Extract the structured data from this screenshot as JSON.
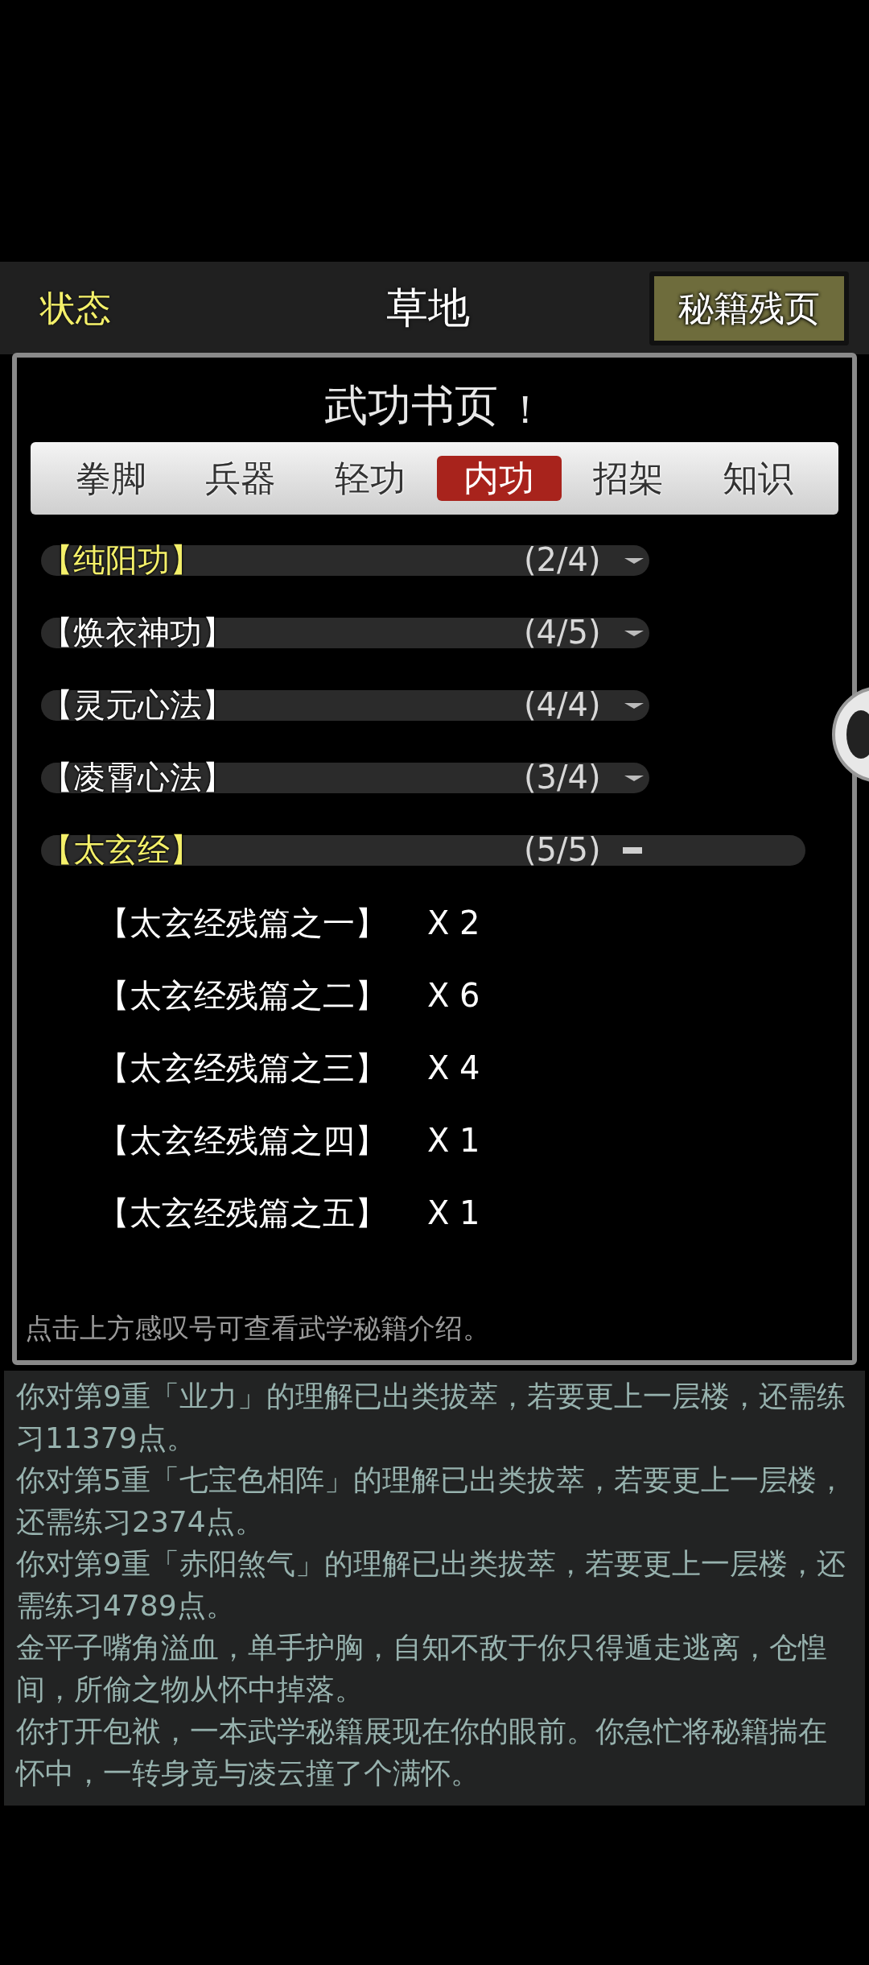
{
  "header": {
    "left": "状态",
    "title": "草地",
    "button": "秘籍残页"
  },
  "dialog": {
    "title": "武功书页",
    "title_mark": "！",
    "tabs": [
      {
        "label": "拳脚",
        "selected": false
      },
      {
        "label": "兵器",
        "selected": false
      },
      {
        "label": "轻功",
        "selected": false
      },
      {
        "label": "内功",
        "selected": true
      },
      {
        "label": "招架",
        "selected": false
      },
      {
        "label": "知识",
        "selected": false
      }
    ],
    "books": [
      {
        "name": "【纯阳功】",
        "count": "(2/4)",
        "highlighted": true,
        "expanded": false
      },
      {
        "name": "【焕衣神功】",
        "count": "(4/5)",
        "highlighted": false,
        "expanded": false
      },
      {
        "name": "【灵元心法】",
        "count": "(4/4)",
        "highlighted": false,
        "expanded": false
      },
      {
        "name": "【凌霄心法】",
        "count": "(3/4)",
        "highlighted": false,
        "expanded": false
      },
      {
        "name": "【太玄经】",
        "count": "(5/5)",
        "highlighted": true,
        "expanded": true,
        "children": [
          {
            "name": "【太玄经残篇之一】",
            "qty": "X 2"
          },
          {
            "name": "【太玄经残篇之二】",
            "qty": "X 6"
          },
          {
            "name": "【太玄经残篇之三】",
            "qty": "X 4"
          },
          {
            "name": "【太玄经残篇之四】",
            "qty": "X 1"
          },
          {
            "name": "【太玄经残篇之五】",
            "qty": "X 1"
          }
        ]
      }
    ],
    "hint": "点击上方感叹号可查看武学秘籍介绍。"
  },
  "log": [
    "你对第9重「业力」的理解已出类拔萃，若要更上一层楼，还需练习11379点。",
    "你对第5重「七宝色相阵」的理解已出类拔萃，若要更上一层楼，还需练习2374点。",
    "你对第9重「赤阳煞气」的理解已出类拔萃，若要更上一层楼，还需练习4789点。",
    "金平子嘴角溢血，单手护胸，自知不敌于你只得遁走逃离，仓惶间，所偷之物从怀中掉落。",
    "你打开包袱，一本武学秘籍展现在你的眼前。你急忙将秘籍揣在怀中，一转身竟与凌云撞了个满怀。"
  ]
}
